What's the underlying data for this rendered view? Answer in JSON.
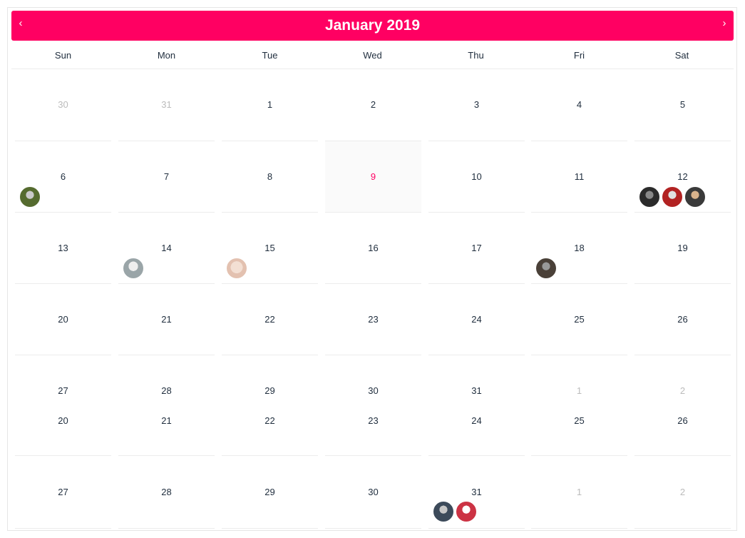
{
  "header": {
    "title": "January 2019",
    "prev_label": "‹",
    "next_label": "›"
  },
  "weekdays": [
    "Sun",
    "Mon",
    "Tue",
    "Wed",
    "Thu",
    "Fri",
    "Sat"
  ],
  "colors": {
    "accent": "#ff0062",
    "muted": "#bbbbbb",
    "text": "#1f2d3d",
    "today_bg": "#fafafa"
  },
  "weeks": [
    [
      {
        "d": "30",
        "muted": true
      },
      {
        "d": "31",
        "muted": true
      },
      {
        "d": "1"
      },
      {
        "d": "2"
      },
      {
        "d": "3"
      },
      {
        "d": "4"
      },
      {
        "d": "5"
      }
    ],
    [
      {
        "d": "6",
        "avatars": 1
      },
      {
        "d": "7"
      },
      {
        "d": "8"
      },
      {
        "d": "9",
        "today": true
      },
      {
        "d": "10"
      },
      {
        "d": "11"
      },
      {
        "d": "12",
        "avatars": 3
      }
    ],
    [
      {
        "d": "13"
      },
      {
        "d": "14",
        "avatars": 1
      },
      {
        "d": "15",
        "avatars": 1
      },
      {
        "d": "16"
      },
      {
        "d": "17"
      },
      {
        "d": "18",
        "avatars": 1
      },
      {
        "d": "19"
      }
    ],
    [
      {
        "d": "20"
      },
      {
        "d": "21"
      },
      {
        "d": "22"
      },
      {
        "d": "23"
      },
      {
        "d": "24"
      },
      {
        "d": "25"
      },
      {
        "d": "26"
      }
    ],
    [
      {
        "d": "27"
      },
      {
        "d": "28"
      },
      {
        "d": "29"
      },
      {
        "d": "30"
      },
      {
        "d": "31"
      },
      {
        "d": "1",
        "muted": true
      },
      {
        "d": "2",
        "muted": true
      }
    ],
    [
      {
        "d": "20"
      },
      {
        "d": "21"
      },
      {
        "d": "22"
      },
      {
        "d": "23"
      },
      {
        "d": "24"
      },
      {
        "d": "25"
      },
      {
        "d": "26"
      }
    ],
    [
      {
        "d": "27"
      },
      {
        "d": "28"
      },
      {
        "d": "29"
      },
      {
        "d": "30"
      },
      {
        "d": "31",
        "avatars": 2
      },
      {
        "d": "1",
        "muted": true
      },
      {
        "d": "2",
        "muted": true
      }
    ]
  ]
}
